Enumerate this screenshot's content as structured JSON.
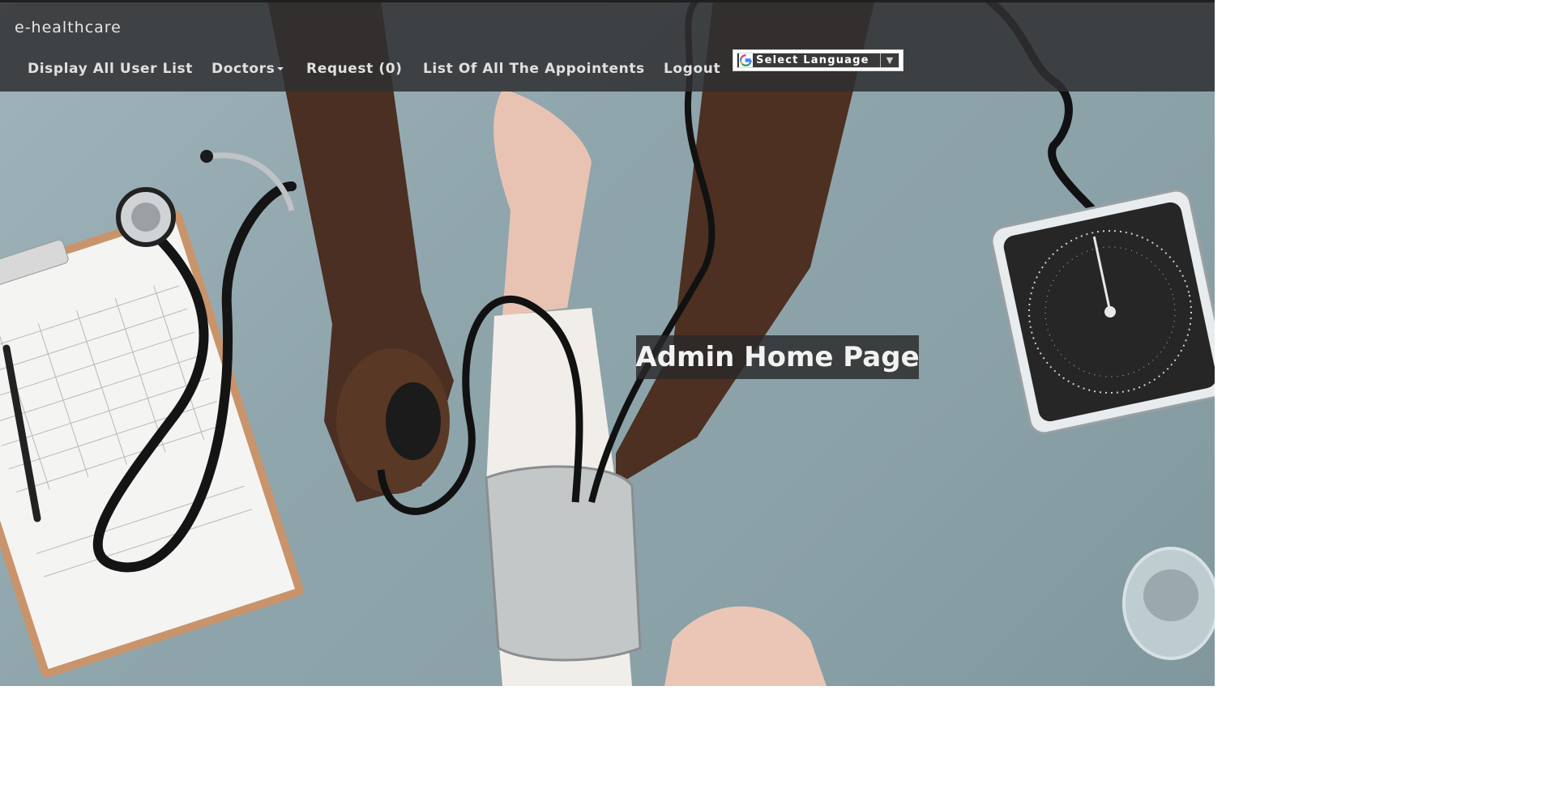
{
  "navbar": {
    "brand": "e-healthcare",
    "items": [
      {
        "label": "Display All User List"
      },
      {
        "label": "Doctors"
      },
      {
        "label": "Request (0)"
      },
      {
        "label": "List Of All The Appointents"
      },
      {
        "label": "Logout"
      }
    ]
  },
  "translate_widget": {
    "label": "Select Language",
    "arrow": "▼",
    "icon": "google-g-icon"
  },
  "hero": {
    "heading": "Admin Home Page",
    "image": "doctor-measuring-blood-pressure-photo"
  },
  "colors": {
    "navbar_bg": "#303032",
    "nav_text": "#e0e0e0",
    "heading_bg": "#282828",
    "heading_text": "#f2f2f2"
  }
}
